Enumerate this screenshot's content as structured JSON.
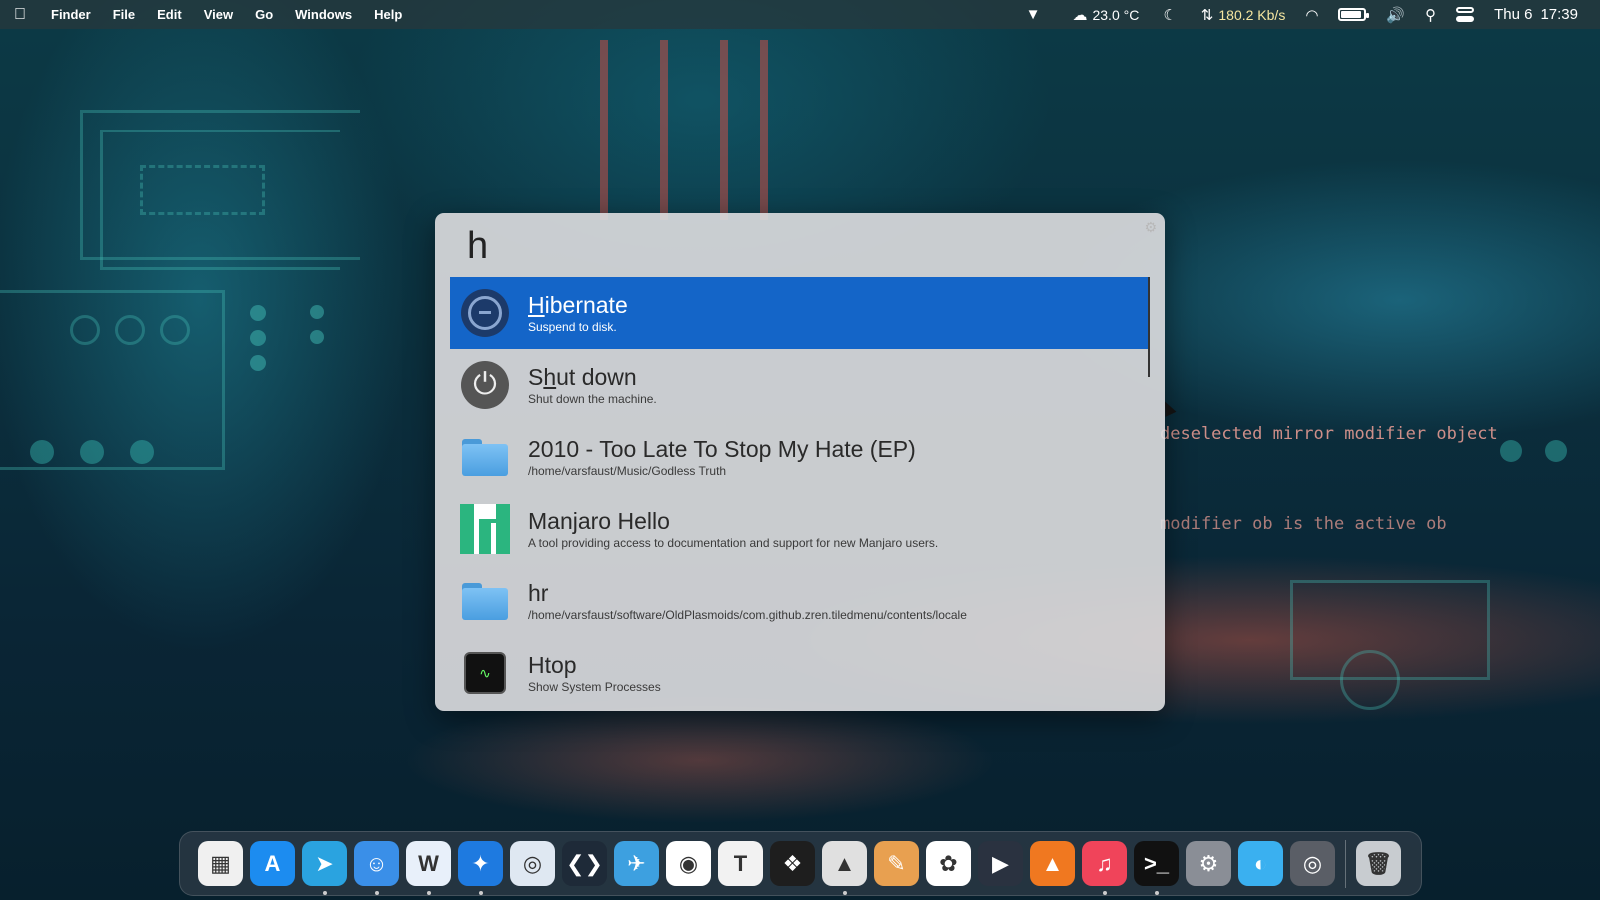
{
  "menubar": {
    "app_name": "Finder",
    "menus": [
      "File",
      "Edit",
      "View",
      "Go",
      "Windows",
      "Help"
    ],
    "weather": "23.0 °C",
    "net_speed": "180.2 Kb/s",
    "battery_level": 0.9,
    "date": "Thu 6",
    "time": "17:39"
  },
  "launcher": {
    "query": "h",
    "results": [
      {
        "title_pre": "",
        "title_match": "H",
        "title_post": "ibernate",
        "subtitle": "Suspend to disk.",
        "icon": "hibernate-icon",
        "selected": true
      },
      {
        "title_pre": "S",
        "title_match": "h",
        "title_post": "ut down",
        "subtitle": "Shut down the machine.",
        "icon": "power-icon",
        "selected": false
      },
      {
        "title": "2010 - Too Late To Stop My Hate (EP)",
        "subtitle": "/home/varsfaust/Music/Godless Truth",
        "icon": "folder-icon"
      },
      {
        "title": "Manjaro Hello",
        "subtitle": "A tool providing access to documentation and support for new Manjaro users.",
        "icon": "manjaro-icon"
      },
      {
        "title": "hr",
        "subtitle": "/home/varsfaust/software/OldPlasmoids/com.github.zren.tiledmenu/contents/locale",
        "icon": "folder-icon"
      },
      {
        "title": "Htop",
        "subtitle": "Show System Processes",
        "icon": "htop-icon"
      }
    ]
  },
  "dock": {
    "apps": [
      {
        "name": "launchpad-icon",
        "color": "#f0f0f0",
        "glyph": "▦",
        "running": false
      },
      {
        "name": "app-store-icon",
        "color": "#1c8cf0",
        "glyph": "A",
        "running": false
      },
      {
        "name": "telegram-icon",
        "color": "#2aa3e0",
        "glyph": "➤",
        "running": true
      },
      {
        "name": "finder-icon",
        "color": "#3a8fe8",
        "glyph": "☺",
        "running": true
      },
      {
        "name": "wps-writer-icon",
        "color": "#e8f0fa",
        "glyph": "W",
        "running": true
      },
      {
        "name": "safari-icon",
        "color": "#1e7ae0",
        "glyph": "✦",
        "running": true
      },
      {
        "name": "preview-icon",
        "color": "#dfe8f2",
        "glyph": "◎",
        "running": false
      },
      {
        "name": "vscode-icon",
        "color": "#1e2a38",
        "glyph": "❮❯",
        "running": false
      },
      {
        "name": "bird-icon",
        "color": "#3da0e0",
        "glyph": "✈",
        "running": false
      },
      {
        "name": "chrome-icon",
        "color": "#ffffff",
        "glyph": "◉",
        "running": false
      },
      {
        "name": "typora-icon",
        "color": "#f2f2f2",
        "glyph": "T",
        "running": false
      },
      {
        "name": "figma-icon",
        "color": "#1e1e1e",
        "glyph": "❖",
        "running": false
      },
      {
        "name": "inkscape-icon",
        "color": "#e0e0e0",
        "glyph": "▲",
        "running": true
      },
      {
        "name": "gimp-icon",
        "color": "#e8a050",
        "glyph": "✎",
        "running": false
      },
      {
        "name": "photos-icon",
        "color": "#ffffff",
        "glyph": "✿",
        "running": false
      },
      {
        "name": "media-player-icon",
        "color": "#2a3240",
        "glyph": "▶",
        "running": false
      },
      {
        "name": "vlc-icon",
        "color": "#f07820",
        "glyph": "▲",
        "running": false
      },
      {
        "name": "music-icon",
        "color": "#f0445a",
        "glyph": "♫",
        "running": true
      },
      {
        "name": "terminal-icon",
        "color": "#111111",
        "glyph": ">_",
        "running": true
      },
      {
        "name": "system-settings-icon",
        "color": "#8a8e96",
        "glyph": "⚙",
        "running": false
      },
      {
        "name": "disk-usage-icon",
        "color": "#3ab0f0",
        "glyph": "◐",
        "running": false
      },
      {
        "name": "screenshot-icon",
        "color": "#5a5e66",
        "glyph": "◎",
        "running": false
      }
    ],
    "trash": {
      "name": "trash-icon",
      "color": "#c8ccd0",
      "glyph": "🗑"
    }
  }
}
